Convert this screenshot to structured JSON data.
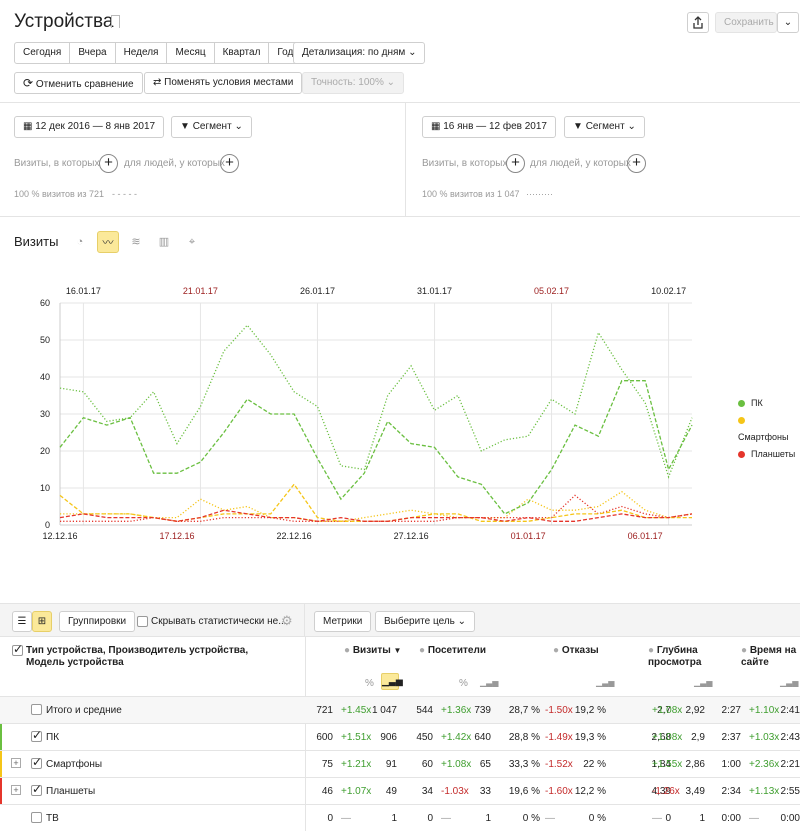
{
  "page": {
    "title": "Устройства"
  },
  "header": {
    "save_label": "Сохранить"
  },
  "periods": [
    "Сегодня",
    "Вчера",
    "Неделя",
    "Месяц",
    "Квартал",
    "Год"
  ],
  "detail_label": "Детализация: по дням",
  "toolbar": {
    "cancel_compare": "Отменить сравнение",
    "swap": "Поменять условия местами",
    "accuracy": "Точность: 100%"
  },
  "left_panel": {
    "date_range": "12 дек 2016 — 8 янв 2017",
    "segment": "Сегмент",
    "visits_which": "Визиты, в которых",
    "people_which": "для людей, у которых",
    "summary": "100 % визитов из 721",
    "dashes": "- - - - -"
  },
  "right_panel": {
    "date_range": "16 янв — 12 фев 2017",
    "segment": "Сегмент",
    "visits_which": "Визиты, в которых",
    "people_which": "для людей, у которых",
    "summary": "100 % визитов из 1 047",
    "dashes": "·········"
  },
  "chart_section": {
    "title": "Визиты"
  },
  "chart_data": {
    "type": "line",
    "top_dates": [
      "16.01.17",
      "21.01.17",
      "26.01.17",
      "31.01.17",
      "05.02.17",
      "10.02.17"
    ],
    "top_dates_red": [
      false,
      true,
      false,
      false,
      true,
      false
    ],
    "bottom_dates": [
      "12.12.16",
      "17.12.16",
      "22.12.16",
      "27.12.16",
      "01.01.17",
      "06.01.17"
    ],
    "bottom_dates_red": [
      false,
      true,
      false,
      false,
      true,
      true
    ],
    "yticks": [
      "0",
      "10",
      "20",
      "30",
      "40",
      "50",
      "60"
    ],
    "ylim": [
      0,
      60
    ],
    "legend": [
      "ПК",
      "Смартфоны",
      "Планшеты"
    ],
    "legend_placement": "right",
    "colors": [
      "#6abf40",
      "#f5c518",
      "#e5352b"
    ],
    "series_primary": [
      {
        "name": "ПК",
        "values": [
          21,
          29,
          27,
          29,
          14,
          14,
          17,
          25,
          34,
          30,
          30,
          18,
          7,
          14,
          28,
          22,
          21,
          13,
          11,
          3,
          6,
          15,
          27,
          24,
          39,
          39,
          15,
          27
        ]
      },
      {
        "name": "Смартфоны",
        "values": [
          8,
          3,
          3,
          3,
          2,
          1,
          2,
          3,
          3,
          3,
          11,
          2,
          1,
          1,
          1,
          2,
          3,
          3,
          1,
          1,
          1,
          2,
          3,
          3,
          4,
          2,
          2,
          2
        ]
      },
      {
        "name": "Планшеты",
        "values": [
          2,
          3,
          2,
          2,
          2,
          1,
          2,
          4,
          3,
          2,
          2,
          1,
          2,
          1,
          1,
          2,
          2,
          2,
          2,
          1,
          2,
          1,
          1,
          2,
          3,
          2,
          2,
          3
        ]
      }
    ],
    "series_compare": [
      {
        "name": "ПК",
        "values": [
          37,
          36,
          28,
          29,
          36,
          22,
          32,
          47,
          54,
          46,
          36,
          32,
          16,
          15,
          35,
          43,
          31,
          35,
          20,
          23,
          24,
          34,
          30,
          52,
          42,
          33,
          13,
          29
        ]
      },
      {
        "name": "Смартфоны",
        "values": [
          3,
          3,
          3,
          3,
          2,
          2,
          7,
          4,
          5,
          2,
          2,
          1,
          1,
          2,
          3,
          4,
          3,
          2,
          2,
          2,
          7,
          4,
          4,
          5,
          9,
          4,
          2,
          3
        ]
      },
      {
        "name": "Планшеты",
        "values": [
          1,
          1,
          1,
          1,
          2,
          1,
          1,
          2,
          2,
          2,
          1,
          1,
          1,
          1,
          1,
          1,
          1,
          2,
          2,
          2,
          2,
          2,
          8,
          3,
          5,
          3,
          2,
          3
        ]
      }
    ]
  },
  "table_toolbar": {
    "grouping": "Группировки",
    "hide_stats": "Скрывать статистически не...",
    "metrics": "Метрики",
    "goal": "Выберите цель"
  },
  "table": {
    "dimension_header": "Тип устройства, Производитель устройства, Модель устройства",
    "col_visits": "Визиты",
    "col_visitors": "Посетители",
    "col_bounce": "Отказы",
    "col_depth": "Глубина просмотра",
    "col_time": "Время на сайте",
    "pct": "%",
    "rows": [
      {
        "name": "Итого и средние",
        "c": [
          "721",
          "+1.45x",
          "1 047",
          "544",
          "+1.36x",
          "739",
          "28,7 %",
          "-1.50x",
          "19,2 %",
          "2,7",
          "+1.08x",
          "2,92",
          "2:27",
          "+1.10x",
          "2:41"
        ]
      },
      {
        "name": "ПК",
        "c": [
          "600",
          "+1.51x",
          "906",
          "450",
          "+1.42x",
          "640",
          "28,8 %",
          "-1.49x",
          "19,3 %",
          "2,68",
          "+1.08x",
          "2,9",
          "2:37",
          "+1.03x",
          "2:43"
        ]
      },
      {
        "name": "Смартфоны",
        "c": [
          "75",
          "+1.21x",
          "91",
          "60",
          "+1.08x",
          "65",
          "33,3 %",
          "-1.52x",
          "22 %",
          "1,84",
          "+1.55x",
          "2,86",
          "1:00",
          "+2.36x",
          "2:21"
        ]
      },
      {
        "name": "Планшеты",
        "c": [
          "46",
          "+1.07x",
          "49",
          "34",
          "-1.03x",
          "33",
          "19,6 %",
          "-1.60x",
          "12,2 %",
          "4,39",
          "-1.26x",
          "3,49",
          "2:34",
          "+1.13x",
          "2:55"
        ]
      },
      {
        "name": "ТВ",
        "c": [
          "0",
          "—",
          "1",
          "0",
          "—",
          "1",
          "0 %",
          "—",
          "0 %",
          "0",
          "—",
          "1",
          "0:00",
          "—",
          "0:00"
        ]
      }
    ]
  }
}
